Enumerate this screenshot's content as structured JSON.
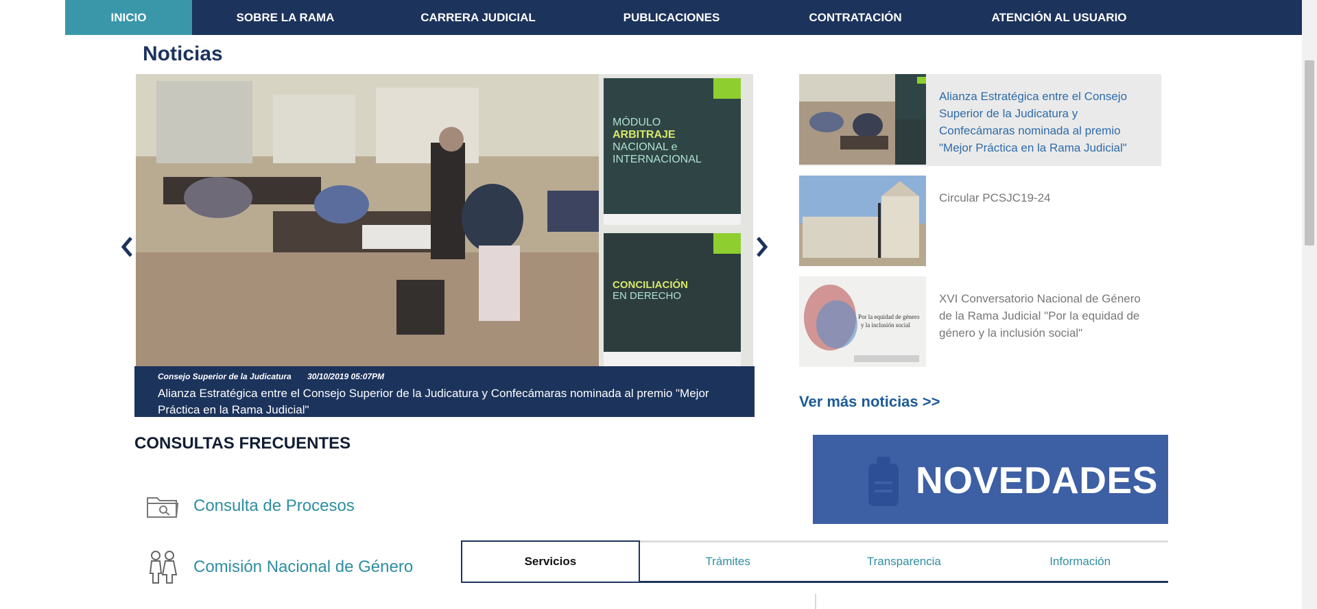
{
  "nav": {
    "items": [
      {
        "label": "INICIO",
        "active": true
      },
      {
        "label": "SOBRE LA RAMA"
      },
      {
        "label": "CARRERA JUDICIAL"
      },
      {
        "label": "PUBLICACIONES"
      },
      {
        "label": "CONTRATACIÓN"
      },
      {
        "label": "ATENCIÓN AL USUARIO"
      }
    ]
  },
  "news": {
    "section_title": "Noticias",
    "featured": {
      "source": "Consejo Superior de la Judicatura",
      "date": "30/10/2019 05:07PM",
      "headline": "Alianza Estratégica entre el Consejo Superior de la Judicatura y Confecámaras nominada al premio \"Mejor Práctica en la Rama Judicial\"",
      "book1_line1": "MÓDULO",
      "book1_line2": "ARBITRAJE",
      "book1_line3": "NACIONAL e",
      "book1_line4": "INTERNACIONAL",
      "book2_line1": "CONCILIACIÓN",
      "book2_line2": "EN DERECHO"
    },
    "list": [
      {
        "title": "Alianza Estratégica entre el Consejo Superior de la Judicatura y Confecámaras nominada al premio \"Mejor Práctica en la Rama Judicial\"",
        "active": true
      },
      {
        "title": "Circular PCSJC19-24"
      },
      {
        "title": "XVI Conversatorio Nacional de Género de la Rama Judicial \"Por la equidad de género y la inclusión social\"",
        "thumb_line1": "Por la equidad de género",
        "thumb_line2": "y la inclusión social"
      }
    ],
    "more_link": "Ver más noticias >>"
  },
  "novedades": {
    "label": "NOVEDADES"
  },
  "consultas": {
    "title": "CONSULTAS FRECUENTES",
    "items": [
      {
        "label": "Consulta de Procesos",
        "icon": "folder-search-icon"
      },
      {
        "label": "Comisión Nacional de Género",
        "icon": "gender-people-icon"
      }
    ]
  },
  "tabs": [
    {
      "label": "Servicios",
      "active": true
    },
    {
      "label": "Trámites"
    },
    {
      "label": "Transparencia"
    },
    {
      "label": "Información"
    }
  ],
  "colors": {
    "navy": "#1c335c",
    "teal": "#3997a9",
    "link_blue": "#2e6ba8",
    "novedades_blue": "#3d5fa4"
  }
}
